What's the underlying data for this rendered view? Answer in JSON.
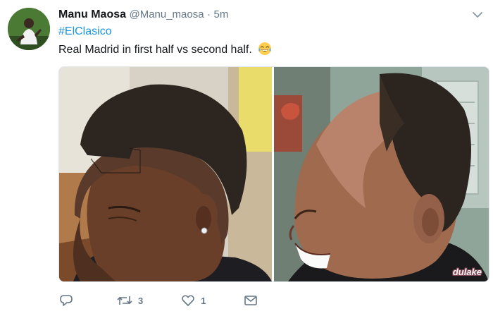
{
  "tweet": {
    "author_name": "Manu Maosa",
    "author_handle": "@Manu_maosa",
    "separator": "·",
    "time": "5m",
    "hashtag": "#ElClasico",
    "text": "Real Madrid in first half vs second half.",
    "emoji": "face-with-tears-of-joy"
  },
  "media": {
    "watermark": "dulake"
  },
  "actions": {
    "retweet_count": "3",
    "like_count": "1"
  },
  "colors": {
    "link": "#1b95e0",
    "muted": "#657786",
    "text": "#14171a"
  }
}
